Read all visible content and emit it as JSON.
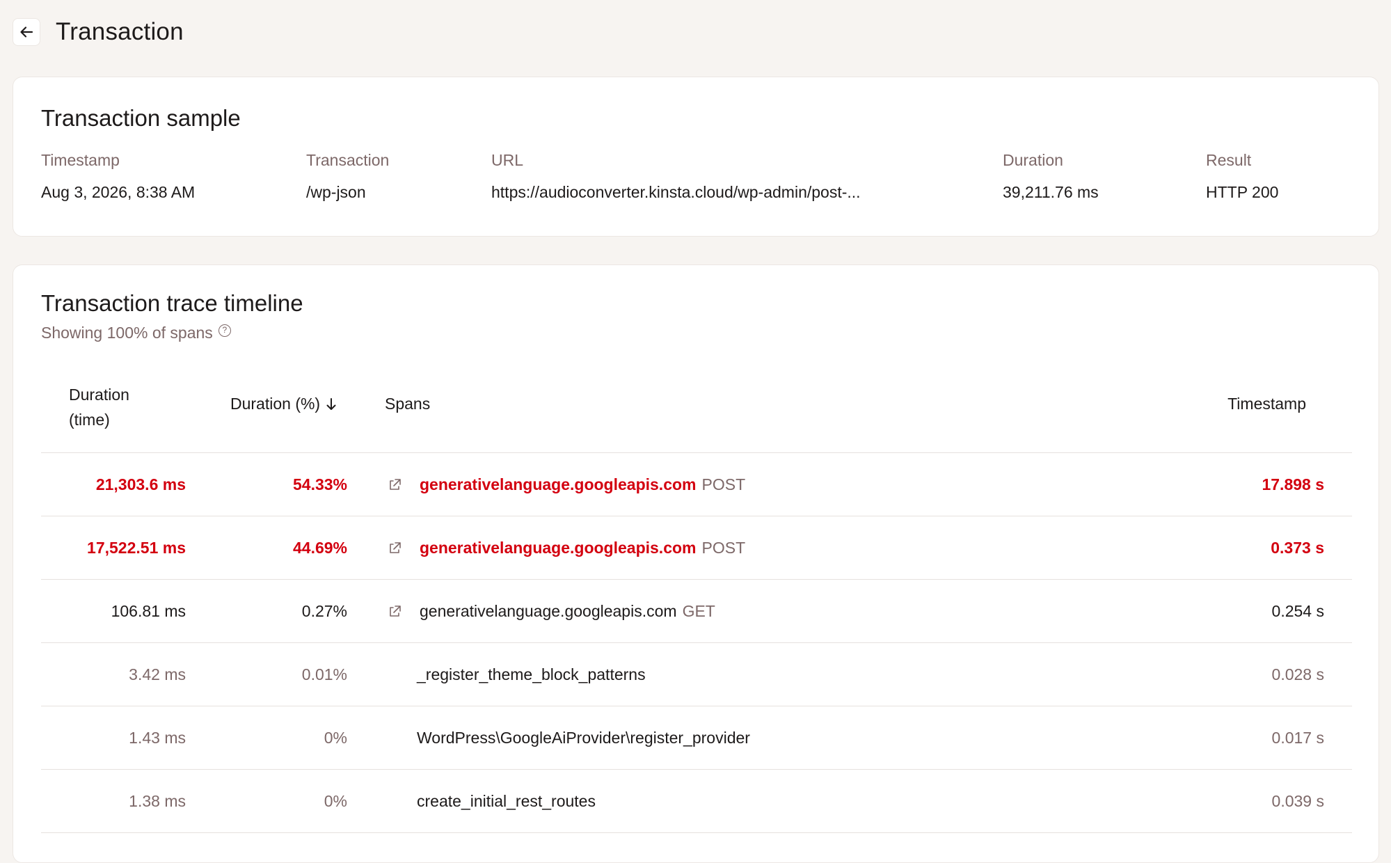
{
  "header": {
    "title": "Transaction"
  },
  "sample": {
    "title": "Transaction sample",
    "fields": [
      {
        "label": "Timestamp",
        "value": "Aug 3, 2026, 8:38 AM"
      },
      {
        "label": "Transaction",
        "value": "/wp-json"
      },
      {
        "label": "URL",
        "value": "https://audioconverter.kinsta.cloud/wp-admin/post-..."
      },
      {
        "label": "Duration",
        "value": "39,211.76 ms"
      },
      {
        "label": "Result",
        "value": "HTTP 200"
      }
    ]
  },
  "trace": {
    "title": "Transaction trace timeline",
    "subtitle": "Showing 100% of spans",
    "columns": {
      "duration_line1": "Duration",
      "duration_line2": "(time)",
      "duration_pct": "Duration (%)",
      "spans": "Spans",
      "timestamp": "Timestamp"
    },
    "rows": [
      {
        "duration": "21,303.6 ms",
        "percent": "54.33%",
        "span": "generativelanguage.googleapis.com",
        "method": "POST",
        "timestamp": "17.898 s",
        "external": true,
        "style": "hot"
      },
      {
        "duration": "17,522.51 ms",
        "percent": "44.69%",
        "span": "generativelanguage.googleapis.com",
        "method": "POST",
        "timestamp": "0.373 s",
        "external": true,
        "style": "hot"
      },
      {
        "duration": "106.81 ms",
        "percent": "0.27%",
        "span": "generativelanguage.googleapis.com",
        "method": "GET",
        "timestamp": "0.254 s",
        "external": true,
        "style": "normal"
      },
      {
        "duration": "3.42 ms",
        "percent": "0.01%",
        "span": "_register_theme_block_patterns",
        "method": "",
        "timestamp": "0.028 s",
        "external": false,
        "style": "muted"
      },
      {
        "duration": "1.43 ms",
        "percent": "0%",
        "span": "WordPress\\GoogleAiProvider\\register_provider",
        "method": "",
        "timestamp": "0.017 s",
        "external": false,
        "style": "muted"
      },
      {
        "duration": "1.38 ms",
        "percent": "0%",
        "span": "create_initial_rest_routes",
        "method": "",
        "timestamp": "0.039 s",
        "external": false,
        "style": "muted"
      }
    ]
  },
  "icons": {
    "back": "arrow-left-icon",
    "help": "help-circle-icon",
    "external": "external-link-icon",
    "sort": "arrow-down-icon"
  },
  "colors": {
    "hot": "#d3000f",
    "muted": "#7d6868",
    "text": "#1d1a1a",
    "background": "#f7f4f1"
  }
}
